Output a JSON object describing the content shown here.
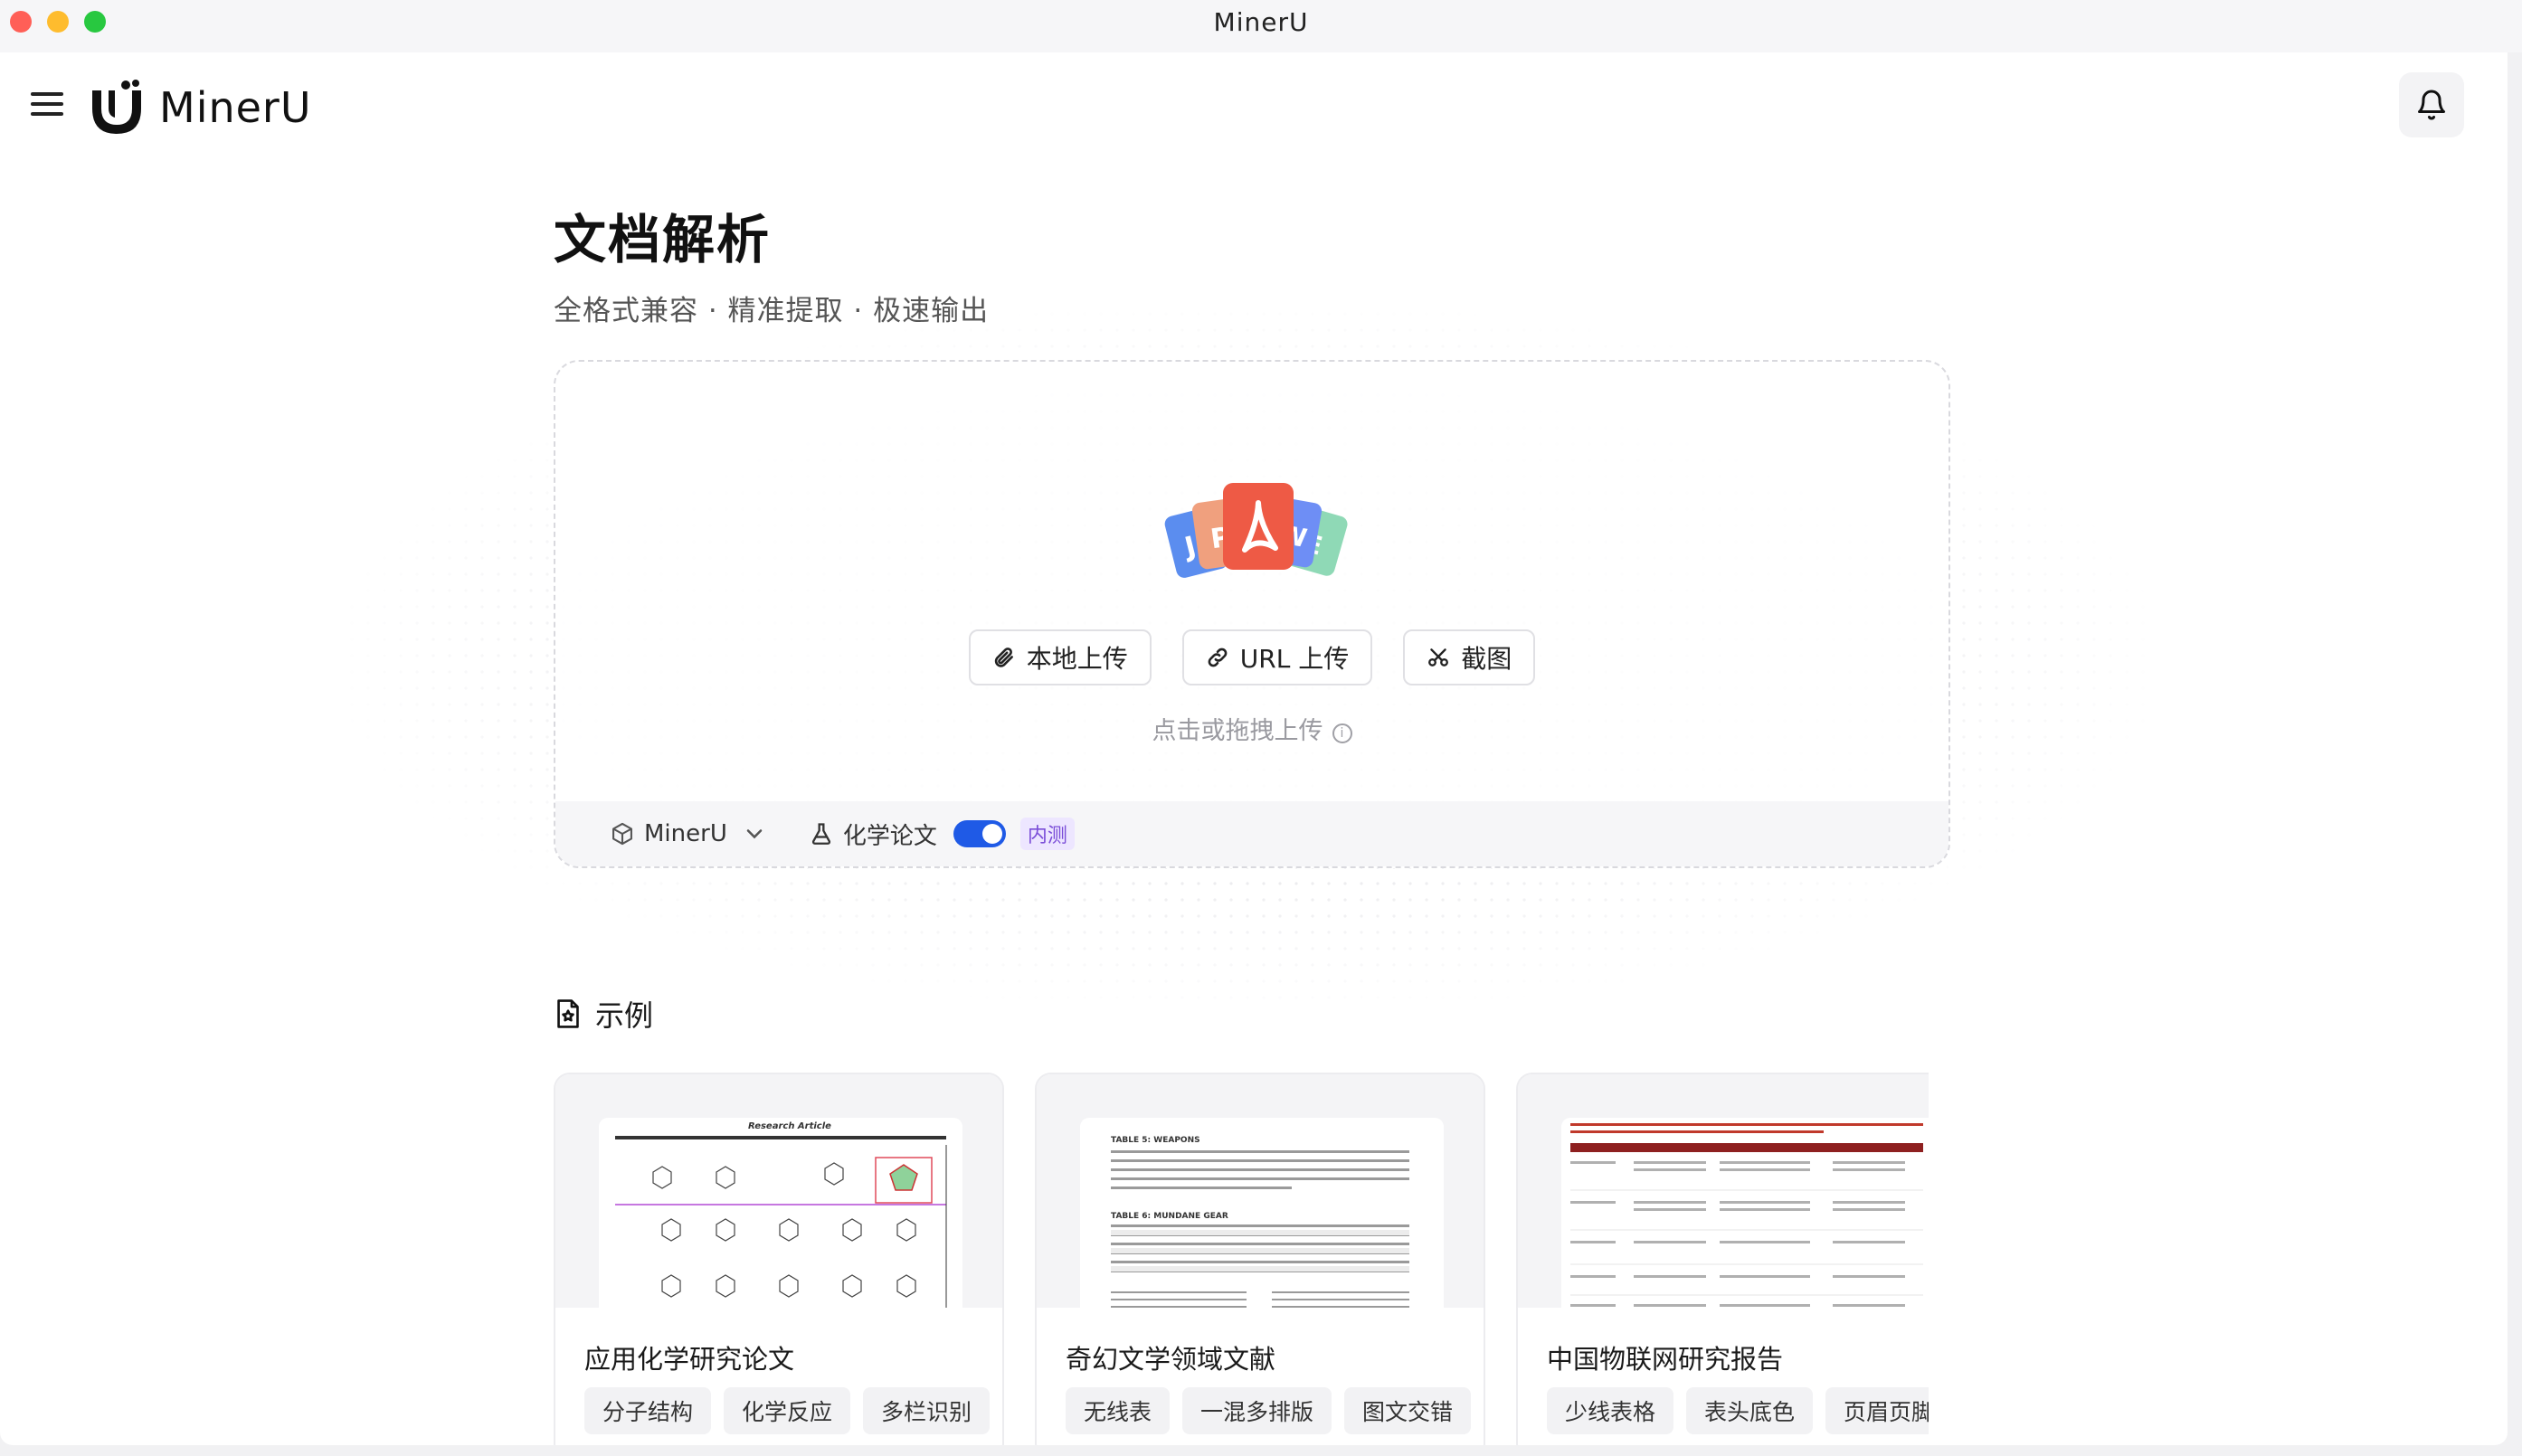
{
  "window": {
    "title": "MinerU"
  },
  "header": {
    "logo_text": "MinerU"
  },
  "main": {
    "title": "文档解析",
    "subtitle": "全格式兼容 · 精准提取 · 极速输出"
  },
  "upload": {
    "buttons": {
      "local": "本地上传",
      "url": "URL 上传",
      "screenshot": "截图"
    },
    "hint": "点击或拖拽上传",
    "options": {
      "model": "MinerU",
      "chem_label": "化学论文",
      "beta": "内测"
    }
  },
  "examples": {
    "title": "示例",
    "cards": [
      {
        "title": "应用化学研究论文",
        "tags": [
          "分子结构",
          "化学反应",
          "多栏识别"
        ],
        "thumb_header": "Research Article"
      },
      {
        "title": "奇幻文学领域文献",
        "tags": [
          "无线表",
          "一混多排版",
          "图文交错"
        ],
        "thumb_header": "TABLE 5: WEAPONS",
        "thumb_header2": "TABLE 6: MUNDANE GEAR"
      },
      {
        "title": "中国物联网研究报告",
        "tags": [
          "少线表格",
          "表头底色",
          "页眉页脚"
        ]
      }
    ]
  },
  "colors": {
    "accent": "#1f5ae6",
    "beta_text": "#7a4dd8",
    "pdf_red": "#ee5a45"
  }
}
